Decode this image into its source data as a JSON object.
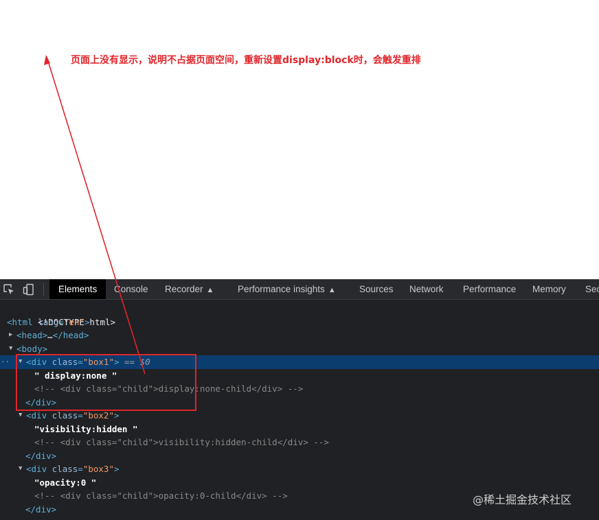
{
  "annotation": {
    "text": "页面上没有显示，说明不占据页面空间，重新设置display:block时，会触发重排"
  },
  "devtools": {
    "tabs": [
      {
        "label": "Elements",
        "active": true
      },
      {
        "label": "Console"
      },
      {
        "label": "Recorder",
        "icon": "flask-icon"
      },
      {
        "label": "Performance insights",
        "icon": "flask-icon"
      },
      {
        "label": "Sources"
      },
      {
        "label": "Network"
      },
      {
        "label": "Performance"
      },
      {
        "label": "Memory"
      },
      {
        "label": "Sec"
      }
    ],
    "dom": {
      "doctype": "<!DOCTYPE html>",
      "html_open": "<html",
      "html_attr": "lang",
      "html_val": "\"en\"",
      "head_open": "<head>",
      "ellipsis": "…",
      "head_close": "</head>",
      "body_open": "<body>",
      "div_open": "<div",
      "class_attr": "class",
      "div_gt": ">",
      "div_close": "</div>",
      "selected_marker": " == $0",
      "row_dots": "··",
      "box1_class": "\"box1\"",
      "box1_text": "\" display:none \"",
      "box1_comment": "<!-- <div class=\"child\">display:none-child</div> -->",
      "box2_class": "\"box2\"",
      "box2_text": "\"visibility:hidden \"",
      "box2_comment": "<!-- <div class=\"child\">visibility:hidden-child</div> -->",
      "box3_class": "\"box3\"",
      "box3_text": "\"opacity:0 \"",
      "box3_comment": "<!-- <div class=\"child\">opacity:0-child</div> -->"
    }
  },
  "watermark": "@稀土掘金技术社区",
  "colors": {
    "annotation": "#e0262b",
    "devtools_bg": "#202124",
    "selected_row": "#0b3d6e"
  }
}
